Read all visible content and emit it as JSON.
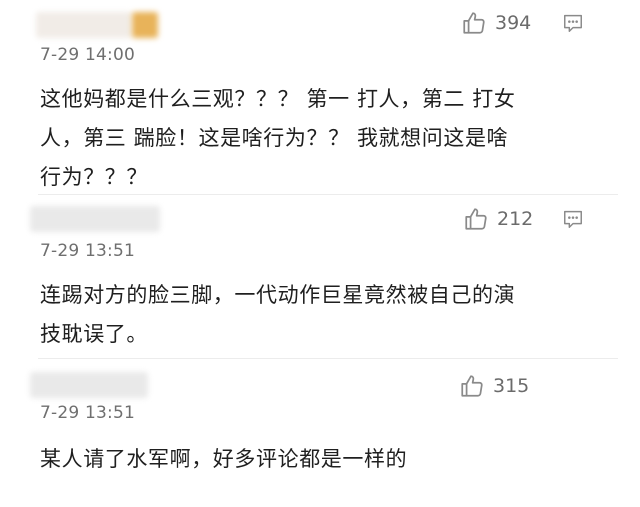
{
  "comments": [
    {
      "time": "7-29 14:00",
      "likes": "394",
      "text_lines": [
        "这他妈都是什么三观？？？ 第一 打人，第二 打女",
        "人，第三 踹脸！这是啥行为？？ 我就想问这是啥",
        "行为？？？"
      ],
      "has_reply_icon": true
    },
    {
      "time": "7-29 13:51",
      "likes": "212",
      "text_lines": [
        "连踢对方的脸三脚，一代动作巨星竟然被自己的演",
        "技耽误了。"
      ],
      "has_reply_icon": true
    },
    {
      "time": "7-29 13:51",
      "likes": "315",
      "text_lines": [
        "某人请了水军啊，好多评论都是一样的"
      ],
      "has_reply_icon": false
    }
  ],
  "icons": {
    "like": "thumbs-up-icon",
    "reply": "comment-bubble-icon"
  },
  "colors": {
    "text": "#1f1f1f",
    "meta": "#6f6f6f",
    "icon": "#8a8a8a",
    "avatar_accent": "#e8b35a"
  }
}
